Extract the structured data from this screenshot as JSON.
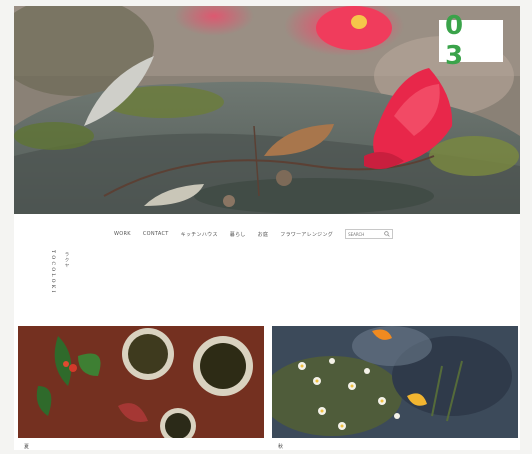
{
  "badge": {
    "number": "0 3"
  },
  "nav": {
    "items": [
      {
        "label": "WORK"
      },
      {
        "label": "CONTACT"
      },
      {
        "label": "キッチンハウス"
      },
      {
        "label": "暮らし"
      },
      {
        "label": "お庭"
      },
      {
        "label": "フラワーアレンジング"
      }
    ],
    "search_placeholder": "SEARCH"
  },
  "logo": {
    "main": "TOCOLOKI",
    "sub": "ラクヤ"
  },
  "posts": [
    {
      "caption": "夏"
    },
    {
      "caption": "秋"
    }
  ],
  "colors": {
    "accent": "#3aa34a",
    "camellia": "#e8274a"
  }
}
